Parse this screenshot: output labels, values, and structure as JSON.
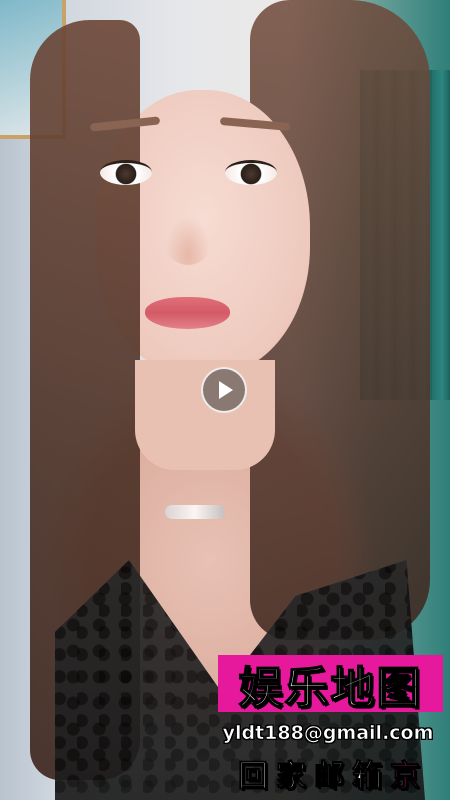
{
  "video": {
    "play_label": "Play"
  },
  "watermark": {
    "title": "娱乐地图",
    "email": "yldt188@gmail.com",
    "footer_main": "回家邮箱",
    "footer_tail": "京"
  },
  "colors": {
    "watermark_accent": "#e6189b",
    "play_button_bg": "rgba(60,60,60,0.55)"
  },
  "icons": {
    "play": "play-icon"
  }
}
